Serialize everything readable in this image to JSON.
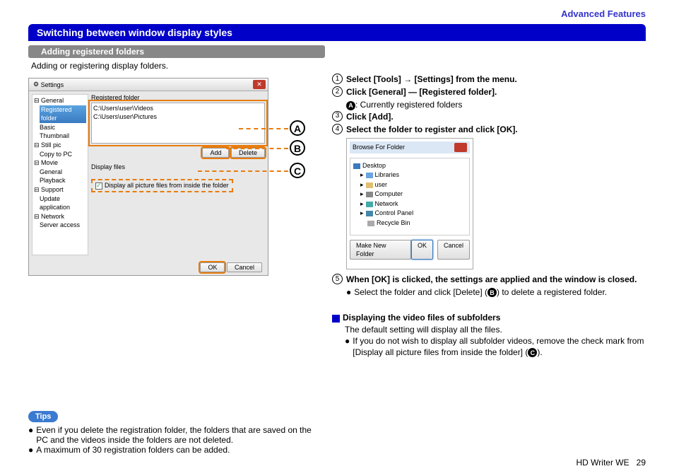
{
  "header": {
    "category": "Advanced Features",
    "title": "Switching between window display styles",
    "subtitle": "Adding registered folders",
    "intro": "Adding or registering display folders."
  },
  "settings_window": {
    "title": "Settings",
    "tree": [
      "General",
      "Registered folder",
      "Basic",
      "Thumbnail",
      "Still pic",
      "Copy to PC",
      "Movie",
      "General",
      "Playback",
      "Support",
      "Update application",
      "Network",
      "Server access"
    ],
    "tree_selected_index": 1,
    "registered_label": "Registered folder",
    "registered_items": [
      "C:\\Users\\user\\Videos",
      "C:\\Users\\user\\Pictures"
    ],
    "add_btn": "Add",
    "delete_btn": "Delete",
    "display_label": "Display files",
    "checkbox_label": "Display all picture files from inside the folder",
    "ok_btn": "OK",
    "cancel_btn": "Cancel"
  },
  "callouts": {
    "a": "A",
    "b": "B",
    "c": "C"
  },
  "steps": {
    "s1": "Select [Tools] → [Settings] from the menu.",
    "s2": "Click [General] — [Registered folder].",
    "s2_sub_label": "A",
    "s2_sub_text": ": Currently registered folders",
    "s3": "Click [Add].",
    "s4": "Select the folder to register and click [OK].",
    "s5": "When [OK] is clicked, the settings are applied and the window is closed.",
    "s5_bullet": "Select the folder and click [Delete] (",
    "s5_bullet_label": "B",
    "s5_bullet_after": ") to delete a registered folder."
  },
  "browse": {
    "title": "Browse For Folder",
    "items": [
      "Desktop",
      "Libraries",
      "user",
      "Computer",
      "Network",
      "Control Panel",
      "Recycle Bin"
    ],
    "make_new": "Make New Folder",
    "ok": "OK",
    "cancel": "Cancel"
  },
  "section2": {
    "heading": "Displaying the video files of subfolders",
    "line1": "The default setting will display all the files.",
    "bullet": "If you do not wish to display all subfolder videos, remove the check mark from [Display all picture files from inside the folder] (",
    "bullet_label": "C",
    "bullet_after": ")."
  },
  "tips": {
    "badge": "Tips",
    "b1": "Even if you delete the registration folder, the folders that are saved on the PC and the videos inside the folders are not deleted.",
    "b2": "A maximum of 30 registration folders can be added."
  },
  "footer": {
    "product": "HD Writer WE",
    "page": "29"
  }
}
